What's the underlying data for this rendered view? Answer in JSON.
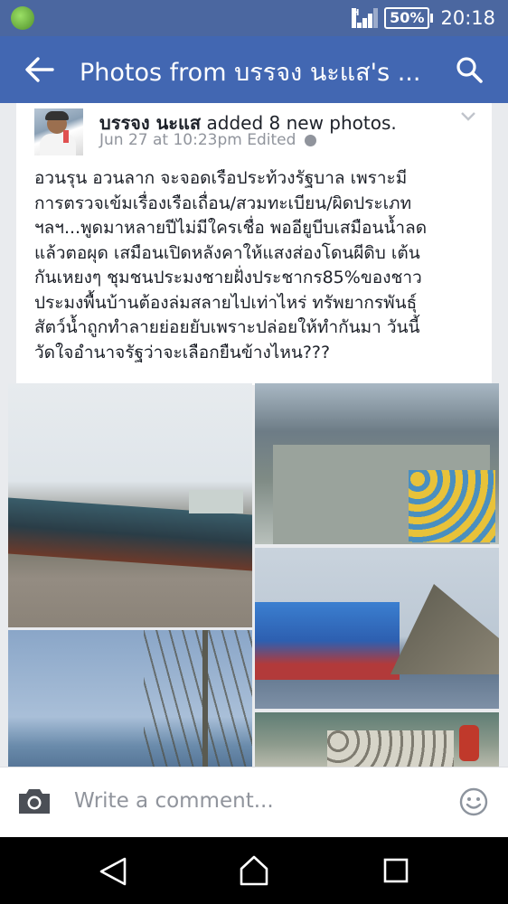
{
  "status_bar": {
    "network": "H",
    "battery": "50%",
    "time": "20:18"
  },
  "app_bar": {
    "title": "Photos from บรรจง นะแส's ..."
  },
  "post": {
    "author": "บรรจง นะแส",
    "action": " added 8 new photos.",
    "timestamp": "Jun 27 at 10:23pm Edited",
    "text": "อวนรุน อวนลาก จะจอดเรือประท้วงรัฐบาล เพราะมี\nการตรวจเข้มเรื่องเรือเถื่อน/สวมทะเบียน/ผิดประเภท\nฯลฯ...พูดมาหลายปีไม่มีใครเชื่อ พออียูบีบเสมือนน้ำลด\nแล้วตอผุด เสมือนเปิดหลังคาให้แสงส่องโดนผีดิบ เต้น\nกันเหยงๆ ชุมชนประมงชายฝั่งประชากร85%ของชาว\nประมงพื้นบ้านต้องล่มสลายไปเท่าไหร่ ทรัพยากรพันธุ์\nสัตว์น้ำถูกทำลายย่อยยับเพราะปล่อยให้ทำกันมา วันนี้\nวัดใจอำนาจรัฐว่าจะเลือกยืนข้างไหน???"
  },
  "comment_bar": {
    "placeholder": "Write a comment..."
  },
  "icons": {
    "back": "arrow-left-icon",
    "search": "search-icon",
    "camera": "camera-icon",
    "emoji": "smiley-icon",
    "privacy": "globe-icon",
    "menu": "chevron-down-icon"
  },
  "colors": {
    "app_bar": "#4267b2",
    "status_bar": "#4b67a0",
    "background": "#e9ebee"
  }
}
